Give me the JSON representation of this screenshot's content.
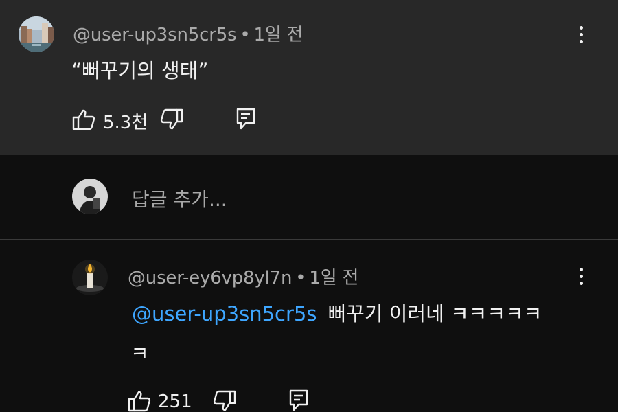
{
  "top_comment": {
    "author": "@user-up3sn5cr5s",
    "separator": "•",
    "time": "1일 전",
    "text": "“뻐꾸기의 생태”",
    "like_count": "5.3천",
    "icons": {
      "like": "thumbs-up-icon",
      "dislike": "thumbs-down-icon",
      "reply": "reply-icon",
      "more": "more-vert-icon"
    }
  },
  "add_reply": {
    "placeholder": "답글 추가..."
  },
  "reply": {
    "author": "@user-ey6vp8yl7n",
    "separator": "•",
    "time": "1일 전",
    "mention": "@user-up3sn5cr5s",
    "text_line1": "뻐꾸기 이러네 ㅋㅋㅋㅋㅋ",
    "text_line2": "ㅋ",
    "like_count": "251"
  },
  "colors": {
    "top_comment_bg": "#282828",
    "page_bg": "#0f0f0f",
    "mention": "#3ea6ff",
    "meta": "#aaaaaa",
    "text": "#f1f1f1"
  }
}
